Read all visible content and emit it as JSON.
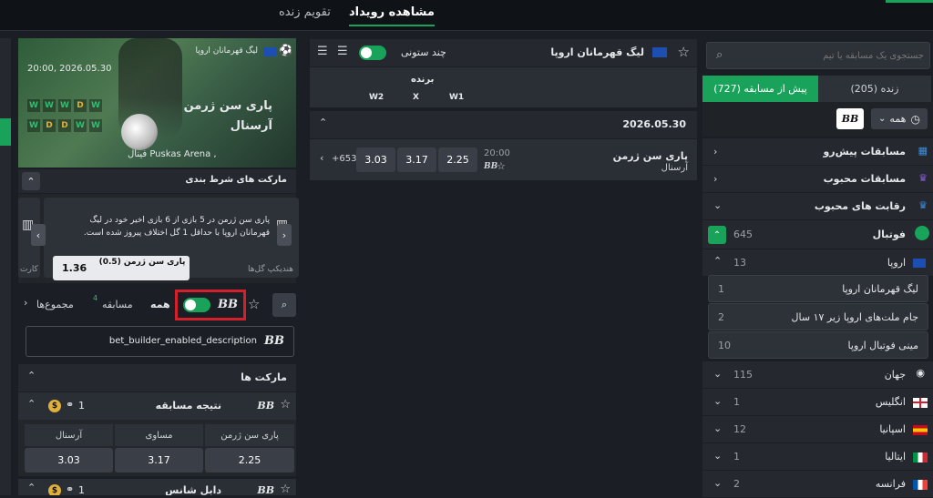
{
  "top_tabs": {
    "event_view": "مشاهده رویداد",
    "live_calendar": "تقویم زنده"
  },
  "left": {
    "search_placeholder": "جستجوی یک مسابقه یا تیم",
    "tab_live": "زنده (205)",
    "tab_prematch": "پیش از مسابقه (727)",
    "filter_all": "همه",
    "nav": [
      {
        "label": "مسابقات پیش‌رو",
        "icon": "calendar-icon"
      },
      {
        "label": "مسابقات محبوب",
        "icon": "trophy-icon"
      },
      {
        "label": "رقابت های محبوب",
        "icon": "trophy-icon"
      }
    ],
    "sport": {
      "label": "فوتبال",
      "count": "645"
    },
    "europe": {
      "label": "اروپا",
      "count": "13"
    },
    "leagues": [
      {
        "label": "لیگ قهرمانان اروپا",
        "count": "1"
      },
      {
        "label": "جام ملت‌های اروپا زیر ۱۷ سال",
        "count": "2"
      },
      {
        "label": "مینی فوتبال اروپا",
        "count": "10"
      }
    ],
    "countries": [
      {
        "label": "جهان",
        "count": "115",
        "flag": "globe"
      },
      {
        "label": "انگلیس",
        "count": "1",
        "flag": "england"
      },
      {
        "label": "اسپانیا",
        "count": "12",
        "flag": "spain"
      },
      {
        "label": "ایتالیا",
        "count": "1",
        "flag": "italy"
      },
      {
        "label": "فرانسه",
        "count": "2",
        "flag": "france"
      }
    ]
  },
  "middle": {
    "league_title": "لیگ قهرمانان اروپا",
    "multi_column": "چند ستونی",
    "winner": "برنده",
    "cols": [
      "W1",
      "X",
      "W2"
    ],
    "date": "2026.05.30",
    "match": {
      "team1": "پاری سن ژرمن",
      "team2": "آرسنال",
      "time": "20:00",
      "odds": [
        "2.25",
        "3.17",
        "3.03"
      ],
      "more": "+653"
    }
  },
  "right": {
    "league": "لیگ قهرمانان اروپا",
    "datetime": "20:00, 2026.05.30",
    "team1": "پاری سن ژرمن",
    "team2": "آرسنال",
    "venue": "فینال Puskas Arena ,",
    "form1": [
      "W",
      "W",
      "W",
      "D",
      "W"
    ],
    "form2": [
      "W",
      "D",
      "D",
      "W",
      "W"
    ],
    "betting_markets": "مارکت های شرط بندی",
    "promo_text": "پاری سن ژرمن در 5 بازی از 6 بازی اخیر خود در لیگ قهرمانان اروپا با حداقل 1 گل اختلاف پیروز شده است.",
    "handicap_label": "هندیکپ گل‌ها",
    "handicap_btn": "پاری سن ژرمن (0.5)",
    "handicap_odd": "1.36",
    "cards_label": "کارت",
    "filter_all": "همه",
    "filter_match": "مسابقه",
    "filter_match_count": "4",
    "filter_totals": "مجموع‌ها",
    "bb_desc": "bet_builder_enabled_description",
    "markets": "مارکت ها",
    "result_title": "نتیجه مسابقه",
    "result_count": "1",
    "result_cols": [
      "پاری سن ژرمن",
      "مساوی",
      "آرسنال"
    ],
    "result_odds": [
      "2.25",
      "3.17",
      "3.03"
    ],
    "double_chance": "دابل شانس",
    "double_count": "1"
  }
}
